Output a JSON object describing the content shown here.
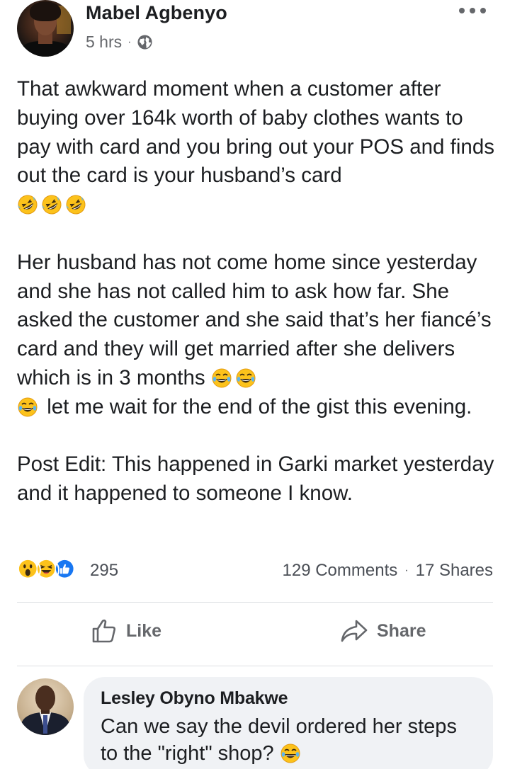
{
  "post": {
    "author": "Mabel Agbenyo",
    "time": "5 hrs",
    "meta_separator": "·",
    "privacy_icon": "globe-icon",
    "more_icon": "more-horizontal-icon",
    "paragraphs": {
      "p1_text": "That awkward moment when a customer after buying over 164k worth of baby clothes wants to pay with card and you bring out your POS and finds out the card is your husband’s card",
      "p1_emojis": [
        "rolling-on-floor-laughing",
        "rolling-on-floor-laughing",
        "rolling-on-floor-laughing"
      ],
      "p2_text_a": "Her husband has not come home since yesterday and she has not called him to ask how far. She asked the customer and she said that’s her fiancé’s card and they will get married after she delivers which is in 3 months",
      "p2_emojis_a": [
        "face-with-tears-of-joy",
        "face-with-tears-of-joy"
      ],
      "p2_emojis_b": [
        "face-with-tears-of-joy"
      ],
      "p2_text_b": "let me wait for the end of the gist this evening.",
      "p3_text": "Post Edit: This happened in Garki market yesterday and it happened to someone I know."
    }
  },
  "stats": {
    "reaction_icons": [
      "wow-reaction",
      "haha-reaction",
      "like-reaction"
    ],
    "reaction_count": "295",
    "comments": "129 Comments",
    "separator": "·",
    "shares": "17 Shares"
  },
  "actions": {
    "like_label": "Like",
    "share_label": "Share"
  },
  "comment": {
    "author": "Lesley Obyno Mbakwe",
    "text": "Can we say the devil ordered her steps to the \"right\" shop?",
    "emoji": "face-with-tears-of-joy"
  },
  "colors": {
    "text": "#1c1e21",
    "secondary": "#65676b",
    "like_blue": "#1877f2",
    "emoji_yellow": "#fcc21b",
    "bubble": "#f0f2f5"
  }
}
